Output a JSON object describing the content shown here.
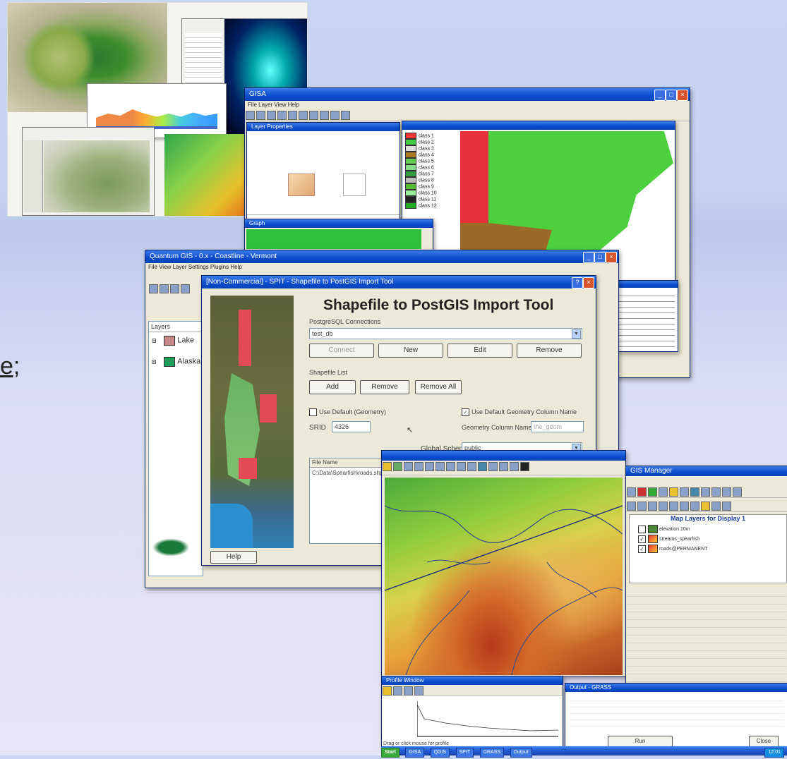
{
  "slide": {
    "partial_text": "e;"
  },
  "gis_window": {
    "title": "GISA",
    "menu": "File  Layer  View  Help"
  },
  "layer_panel_window": {
    "title": "Layer Properties"
  },
  "small_window": {
    "title": "Graph"
  },
  "qgis_window": {
    "title": "Quantum GIS - 0.x - Coastline - Vermont",
    "menu": "File  View  Layer  Settings  Plugins  Help",
    "layers_label": "Layers",
    "layers": [
      {
        "name": "Lake",
        "color": "#c8888a"
      },
      {
        "name": "Alaska",
        "color": "#1f9d5b"
      }
    ]
  },
  "shp_window": {
    "title": "[Non-Commercial] - SPIT - Shapefile to PostGIS Import Tool",
    "heading": "Shapefile to PostGIS Import Tool",
    "connections_label": "PostgreSQL Connections",
    "connection_value": "test_db",
    "conn_buttons": [
      "Connect",
      "New",
      "Edit",
      "Remove"
    ],
    "shapefile_list_label": "Shapefile List",
    "list_buttons": [
      "Add",
      "Remove",
      "Remove All"
    ],
    "use_default_geometry": "Use Default (Geometry)",
    "use_default_srid": "Use Default Geometry Column Name",
    "srid_label": "SRID",
    "srid_value": "4326",
    "geometry_column_label": "Geometry Column Name",
    "geometry_column_value": "the_geom",
    "schema_label": "Global Schema",
    "schema_value": "public",
    "file_name_header": "File Name",
    "file_row": "C:\\Data\\Spearfish\\roads.shp",
    "help_button": "Help"
  },
  "grass_window": {
    "title": "GIS Manager",
    "map_layers_title": "Map Layers for Display 1",
    "layers": [
      "elevation.10m",
      "streams_spearfish",
      "roads@PERMANENT"
    ],
    "output_title": "Output - GRASS",
    "run_button": "Run",
    "close_button": "Close",
    "profile_title": "Profile Window",
    "status": "Drag or click mouse for profile"
  },
  "taskbar": {
    "start": "Start",
    "items": [
      "GISA",
      "QGIS",
      "SPIT",
      "GRASS",
      "Output"
    ],
    "clock": "12:01"
  },
  "colors": {
    "desktop_top": "#c9d6f2",
    "desktop_bottom": "#e6e4f7",
    "xp_title": "#0a4ccc",
    "map_green": "#4cd03e",
    "map_red": "#e5323a",
    "map_brown": "#9a6a28"
  }
}
